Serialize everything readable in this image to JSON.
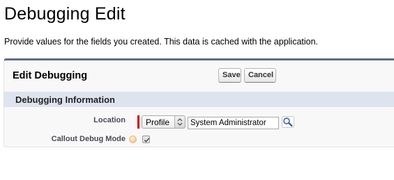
{
  "page": {
    "title": "Debugging Edit",
    "description": "Provide values for the fields you created. This data is cached with the application."
  },
  "panel": {
    "title": "Edit Debugging",
    "save_label": "Save",
    "cancel_label": "Cancel"
  },
  "section": {
    "title": "Debugging Information"
  },
  "fields": {
    "location": {
      "label": "Location",
      "type_selected": "Profile",
      "value": "System Administrator",
      "required": true
    },
    "callout_debug_mode": {
      "label": "Callout Debug Mode",
      "checked": true
    }
  },
  "colors": {
    "panel_border_top": "#5d6d86",
    "section_background": "#dde4ee",
    "required_marker": "#cc0000"
  },
  "icons": {
    "select_arrow": "updown-chevron-icon",
    "lookup": "lookup-magnifier-icon",
    "help": "help-bubble-icon",
    "check": "checkmark-icon"
  }
}
